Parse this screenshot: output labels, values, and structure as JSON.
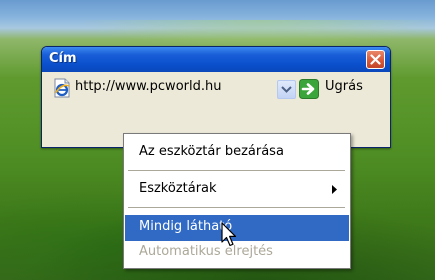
{
  "toolbar_window": {
    "title": "Cím",
    "address_value": "http://www.pcworld.hu",
    "go_label": "Ugrás"
  },
  "context_menu": {
    "items": [
      {
        "label": "Az eszköztár bezárása"
      },
      {
        "label": "Eszköztárak"
      },
      {
        "label": "Mindig látható"
      },
      {
        "label": "Automatikus elrejtés"
      }
    ]
  },
  "colors": {
    "titlebar": "#0a4fcc",
    "highlight": "#316ac5",
    "close_button": "#d85a3a",
    "disabled_text": "#aca899"
  },
  "icons": [
    "ie-page-icon",
    "chevron-down-icon",
    "go-arrow-icon",
    "close-icon",
    "submenu-arrow-icon",
    "mouse-cursor-icon"
  ]
}
